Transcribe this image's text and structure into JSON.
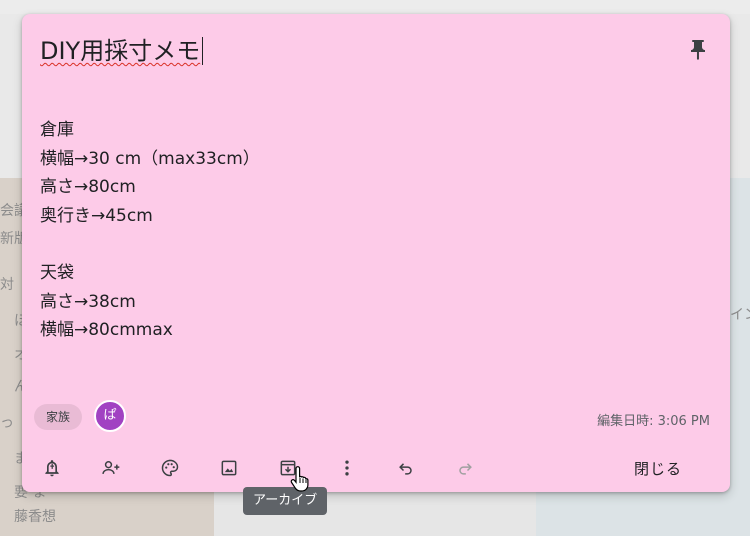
{
  "note": {
    "title": "DIY用採寸メモ",
    "lines": [
      {
        "text": "倉庫"
      },
      {
        "text": "横幅→30 cm（max33cm）"
      },
      {
        "text": "高さ→80cm"
      },
      {
        "text": "奥行き→45cm"
      },
      {
        "text": ""
      },
      {
        "text": "天袋"
      },
      {
        "text": "高さ→38cm"
      },
      {
        "text": "横幅→80cmmax"
      }
    ],
    "label_chip": "家族",
    "collaborator_initial": "ぱ",
    "edited": "編集日時: 3:06 PM"
  },
  "toolbar": {
    "close_label": "閉じる",
    "tooltip": "アーカイブ",
    "icons": [
      "remind-me-icon",
      "collaborator-icon",
      "palette-icon",
      "image-icon",
      "archive-icon",
      "more-icon",
      "undo-icon",
      "redo-icon"
    ]
  },
  "background": {
    "fragments": [
      "会議",
      "新版",
      "対",
      "ほ",
      "オ",
      "ん",
      "っ",
      "ま",
      "要 ま",
      "藤香想",
      "イン"
    ]
  },
  "colors": {
    "note_bg": "#fdcbe8",
    "avatar_bg": "#a142c2",
    "tooltip_bg": "#5f6368",
    "spellcheck": "#d93025"
  }
}
